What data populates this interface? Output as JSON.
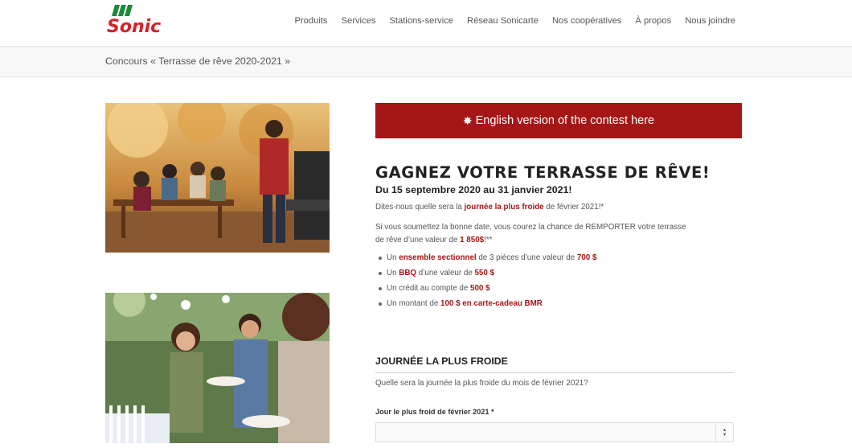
{
  "brand": {
    "logo_text": "Sonic",
    "primary_color": "#a51616",
    "logo_red": "#d62027",
    "logo_green": "#1a8a3a"
  },
  "nav": {
    "items": [
      {
        "label": "Produits"
      },
      {
        "label": "Services"
      },
      {
        "label": "Stations-service"
      },
      {
        "label": "Réseau Sonicarte"
      },
      {
        "label": "Nos coopératives"
      },
      {
        "label": "À propos"
      },
      {
        "label": "Nous joindre"
      }
    ]
  },
  "breadcrumb": {
    "title": "Concours « Terrasse de rêve 2020-2021 »"
  },
  "images": [
    {
      "icon": "photo-bbq-terrace-family"
    },
    {
      "icon": "photo-friends-serving-food"
    }
  ],
  "english_button": {
    "icon": "gear-star-icon",
    "label": "English version of the contest here"
  },
  "contest": {
    "heading": "GAGNEZ VOTRE TERRASSE DE RÊVE!",
    "dates": "Du 15 septembre 2020 au 31 janvier 2021!",
    "intro_before": "Dites-nous quelle sera la ",
    "intro_highlight": "journée la plus froide",
    "intro_after": " de février 2021!*",
    "chance_before": "Si vous soumettez la bonne date, vous courez la chance de REMPORTER votre terrasse de rêve d’une valeur de ",
    "chance_highlight": "1 850$",
    "chance_after": "!**"
  },
  "prizes": [
    {
      "before": "Un ",
      "highlight": "ensemble sectionnel",
      "middle": " de 3 pièces d’une valeur de ",
      "highlight2": "700 $"
    },
    {
      "before": "Un ",
      "highlight": "BBQ",
      "middle": " d’une valeur de ",
      "highlight2": "550 $"
    },
    {
      "before": "Un crédit au compte de ",
      "highlight": "500 $",
      "middle": "",
      "highlight2": ""
    },
    {
      "before": "Un montant de ",
      "highlight": "100 $ en carte-cadeau BMR",
      "middle": "",
      "highlight2": ""
    }
  ],
  "form": {
    "section_title": "JOURNÉE LA PLUS FROIDE",
    "question": "Quelle sera la journée la plus froide du mois de février 2021?",
    "field_label": "Jour le plus froid de février 2021",
    "required_mark": "*",
    "select_value": ""
  }
}
